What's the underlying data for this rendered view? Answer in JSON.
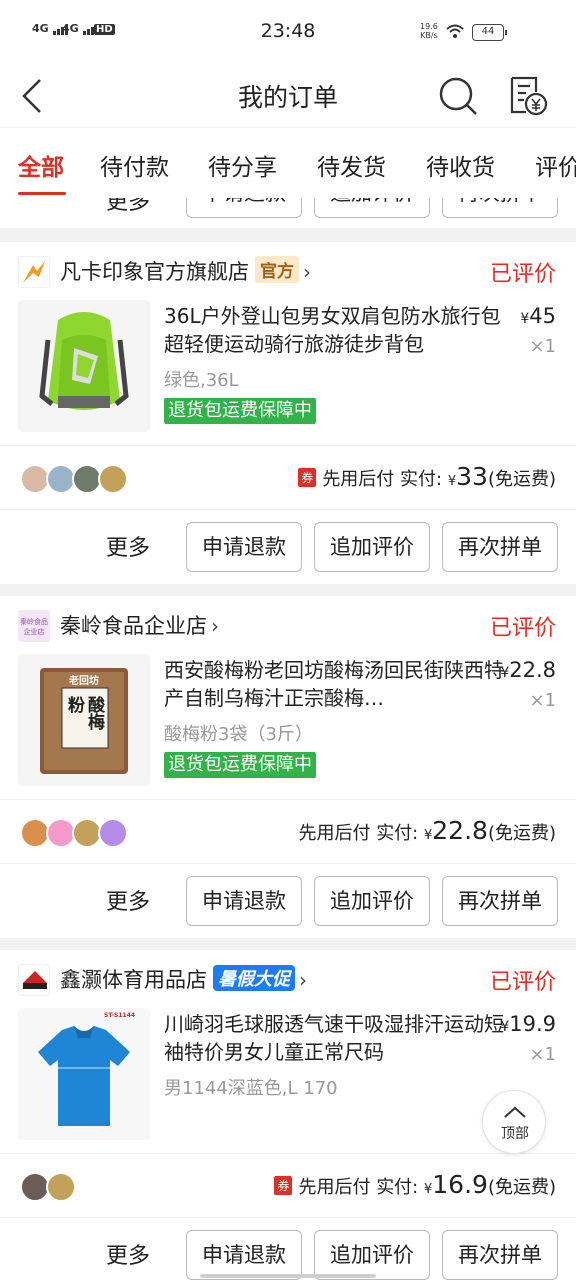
{
  "status_bar": {
    "sim1": "4G",
    "sim2": "4G",
    "hd": "HD",
    "time": "23:48",
    "speed_value": "19.6",
    "speed_unit": "KB/s",
    "battery": "44"
  },
  "nav": {
    "title": "我的订单"
  },
  "tabs": [
    "全部",
    "待付款",
    "待分享",
    "待发货",
    "待收货",
    "评价"
  ],
  "labels": {
    "more": "更多",
    "refund": "申请退款",
    "add_review": "追加评价",
    "rebuy": "再次拼单",
    "pay_later": "先用后付",
    "paid": "实付:",
    "yen": "¥",
    "free_shipping": "(免运费)",
    "guarantee": "退货包运费保障中",
    "coupon": "券",
    "top": "顶部"
  },
  "orders": [
    {
      "shop": "凡卡印象官方旗舰店",
      "shop_tag": "官方",
      "status": "已评价",
      "product": "36L户外登山包男女双肩包防水旅行包超轻便运动骑行旅游徒步背包",
      "price": "45",
      "qty": "×1",
      "spec": "绿色,36L",
      "paid_amount": "33"
    },
    {
      "shop": "秦岭食品企业店",
      "shop_logo_text": "秦岭食品企业店",
      "status": "已评价",
      "product": "西安酸梅粉老回坊酸梅汤回民街陕西特产自制乌梅汁正宗酸梅…",
      "price": "22.8",
      "qty": "×1",
      "spec": "酸梅粉3袋（3斤）",
      "package_brand": "老回坊",
      "package_name": "酸梅粉",
      "paid_amount": "22.8"
    },
    {
      "shop": "鑫灏体育用品店",
      "shop_tag": "暑假大促",
      "status": "已评价",
      "product": "川崎羽毛球服透气速干吸湿排汗运动短袖特价男女儿童正常尺码",
      "price": "19.9",
      "qty": "×1",
      "spec": "男1144深蓝色,L 170",
      "shirt_code": "ST-S1144",
      "paid_amount": "16.9"
    }
  ],
  "colors": {
    "accent": "#e02e24",
    "guarantee": "#32b34a",
    "promo": "#1e7cf0"
  }
}
